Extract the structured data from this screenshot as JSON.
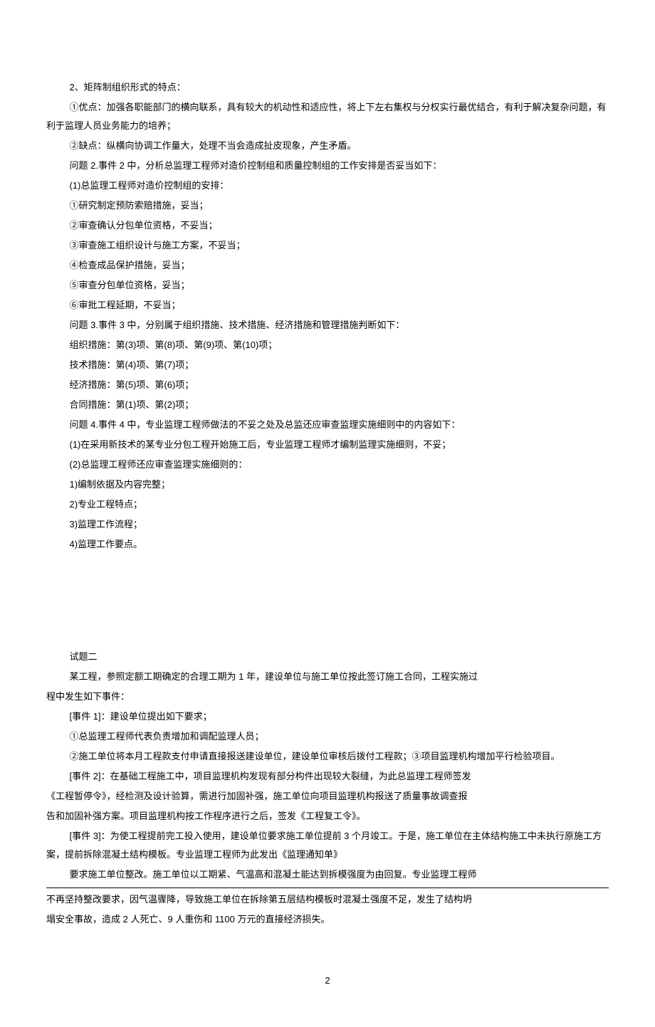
{
  "section1": {
    "p1": "2、矩阵制组织形式的特点：",
    "p2": "①优点：加强各职能部门的横向联系，具有较大的机动性和适应性，将上下左右集权与分权实行最优结合，有利于解决复杂问题，有利于监理人员业务能力的培养；",
    "p3": "②缺点：纵横向协调工作量大，处理不当会造成扯皮现象，产生矛盾。",
    "p4": "问题 2.事件 2 中，分析总监理工程师对造价控制组和质量控制组的工作安排是否妥当如下：",
    "p5": "(1)总监理工程师对造价控制组的安排：",
    "p6": "①研究制定预防索赔措施，妥当；",
    "p7": "②审查确认分包单位资格，不妥当；",
    "p8": "③审查施工组织设计与施工方案，不妥当；",
    "p9": "④检查成品保护措施，妥当；",
    "p10": "⑤审查分包单位资格，妥当；",
    "p11": "⑥审批工程延期，不妥当；",
    "p12": "问题 3.事件 3 中，分别属于组织措施、技术措施、经济措施和管理措施判断如下：",
    "p13": "组织措施：第(3)项、第(8)项、第(9)项、第(10)项；",
    "p14": "技术措施：第(4)项、第(7)项；",
    "p15": "经济措施：第(5)项、第(6)项；",
    "p16": "合同措施：第(1)项、第(2)项；",
    "p17": "问题 4.事件 4 中，专业监理工程师做法的不妥之处及总监还应审查监理实施细则中的内容如下：",
    "p18": "(1)在采用新技术的某专业分包工程开始施工后，专业监理工程师才编制监理实施细则，不妥；",
    "p19": "(2)总监理工程师还应审查监理实施细则的：",
    "p20": "1)编制依据及内容完整；",
    "p21": "2)专业工程特点；",
    "p22": "3)监理工作流程；",
    "p23": "4)监理工作要点。"
  },
  "section2": {
    "title": "试题二",
    "intro1": "某工程，参照定额工期确定的合理工期为 1 年，建设单位与施工单位按此签订施工合同，工程实施过",
    "intro2": "程中发生如下事件：",
    "event1_header": "[事件 1]：建设单位提出如下要求；",
    "event1_p1": "①总监理工程师代表负责增加和调配监理人员；",
    "event1_p2": "②施工单位将本月工程款支付申请直接报送建设单位，建设单位审核后拨付工程款；③项目监理机构增加平行检验项目。",
    "event2_header": "[事件 2]：在基础工程施工中，项目监理机构发现有部分构件出现较大裂缝，为此总监理工程师签发",
    "event2_p1": "《工程暂停令》，经检测及设计验算，需进行加固补强，施工单位向项目监理机构报送了质量事故调查报",
    "event2_p2": "告和加固补强方案。项目监理机构按工作程序进行之后，签发《工程复工令》。",
    "event3_header": "[事件 3]：为使工程提前完工投入使用，建设单位要求施工单位提前 3 个月竣工。于是，施工单位在主体结构施工中未执行原施工方案，提前拆除混凝土结构模板。专业监理工程师为此发出《监理通知单》",
    "event3_u1": "要求施工单位整改。施工单位以工期紧、气温高和混凝土能达到拆模强度为由回复。专业监理工程师",
    "event3_p2": "不再坚持整改要求，因气温骤降，导致施工单位在拆除第五层结构模板时混凝土强度不足，发生了结构坍",
    "event3_p3": "塌安全事故，造成 2 人死亡、9 人重伤和 1100 万元的直接经济损失。"
  },
  "pageNumber": "2"
}
